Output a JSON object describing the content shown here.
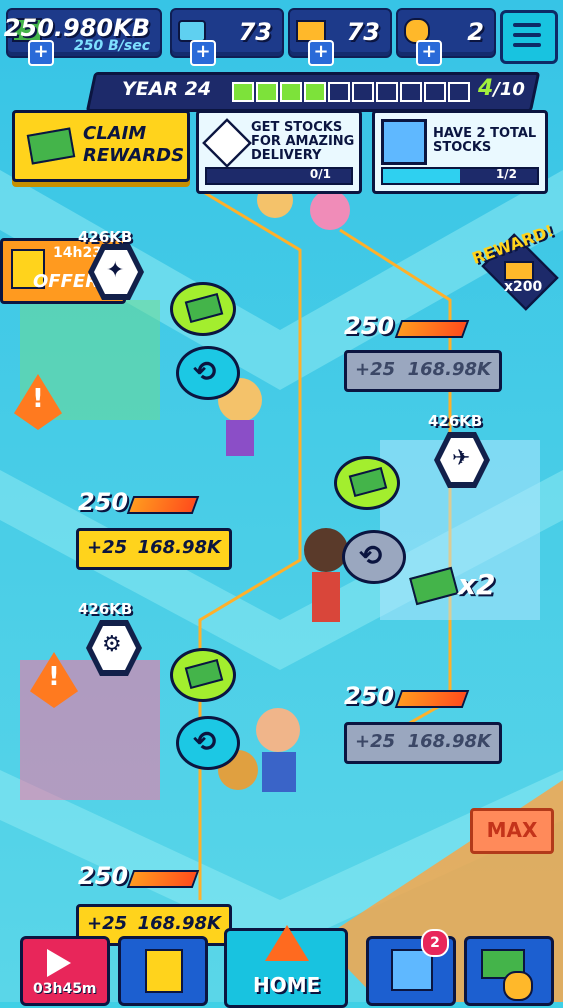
{
  "resources": {
    "kb": {
      "value": "250.980KB",
      "rate": "250 B/sec"
    },
    "tickets": {
      "value": "73"
    },
    "gold": {
      "value": "73"
    },
    "coins": {
      "value": "2"
    }
  },
  "year": {
    "label": "YEAR 24",
    "progress": 4,
    "total": 10,
    "count_text": "4",
    "total_text": "/10"
  },
  "claim": {
    "label_line1": "CLAIM",
    "label_line2": "REWARDS"
  },
  "quests": [
    {
      "text_line1": "GET STOCKS",
      "text_line2": "FOR AMAZING",
      "text_line3": "DELIVERY",
      "progress_text": "0/1",
      "progress": 0.0
    },
    {
      "text_line1": "HAVE 2 TOTAL",
      "text_line2": "STOCKS",
      "progress_text": "1/2",
      "progress": 0.5
    }
  ],
  "offer": {
    "timer": "14h23m",
    "label": "OFFER"
  },
  "reward": {
    "label": "REWARD!",
    "count": "x200"
  },
  "buildings": [
    {
      "kb": "426KB"
    },
    {
      "kb": "426KB"
    },
    {
      "kb": "426KB"
    }
  ],
  "upgrades": [
    {
      "level": "250",
      "bonus": "+25",
      "price": "168.98K",
      "style": "grey"
    },
    {
      "level": "250",
      "bonus": "+25",
      "price": "168.98K",
      "style": "yellow"
    },
    {
      "level": "250",
      "bonus": "+25",
      "price": "168.98K",
      "style": "grey"
    },
    {
      "level": "250",
      "bonus": "+25",
      "price": "168.98K",
      "style": "yellow"
    }
  ],
  "multiplier": "x2",
  "max_label": "MAX",
  "nav": {
    "video_timer": "03h45m",
    "home": "HOME",
    "shop_badge": "2"
  },
  "colors": {
    "accent_yellow": "#ffd31c",
    "navy": "#0b1540",
    "lime": "#a3ee2e",
    "cyan": "#18c3e0"
  }
}
